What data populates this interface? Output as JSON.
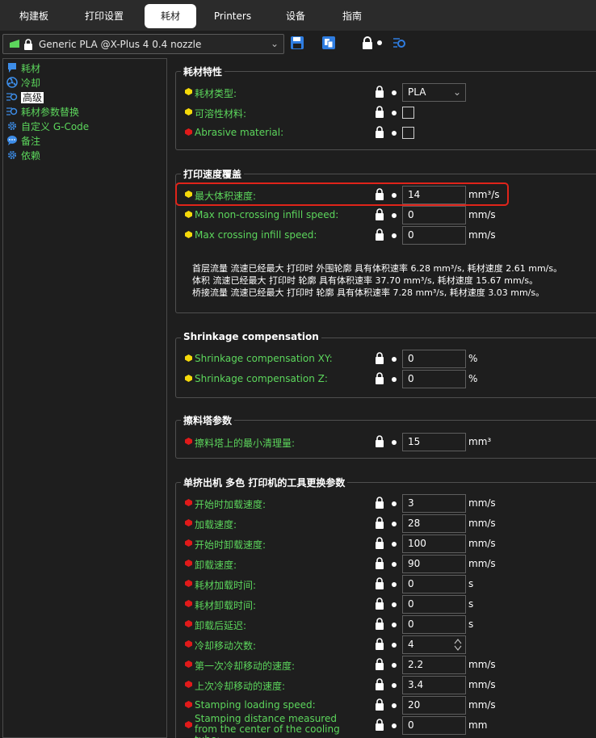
{
  "tabs": [
    {
      "label": "构建板",
      "active": false
    },
    {
      "label": "打印设置",
      "active": false
    },
    {
      "label": "耗材",
      "active": true
    },
    {
      "label": "Printers",
      "active": false
    },
    {
      "label": "设备",
      "active": false
    },
    {
      "label": "指南",
      "active": false
    }
  ],
  "preset": {
    "name": "Generic PLA @X-Plus 4 0.4 nozzle"
  },
  "sidebar": {
    "items": [
      {
        "label": "耗材",
        "icon": "filament-icon"
      },
      {
        "label": "冷却",
        "icon": "fan-icon"
      },
      {
        "label": "高级",
        "icon": "advanced-icon",
        "selected": true
      },
      {
        "label": "耗材参数替换",
        "icon": "override-icon"
      },
      {
        "label": "自定义 G-Code",
        "icon": "gear-icon"
      },
      {
        "label": "备注",
        "icon": "note-icon"
      },
      {
        "label": "依赖",
        "icon": "dependency-icon"
      }
    ]
  },
  "colors": {
    "green_label": "#5cd65c",
    "yellow_dot": "#f5d90a",
    "red_dot": "#e01a1a",
    "highlight": "#e0241a"
  },
  "sections": {
    "filament_props": {
      "title": "耗材特性",
      "rows": [
        {
          "label": "耗材类型:",
          "dot": "yellow",
          "value": "PLA",
          "kind": "select"
        },
        {
          "label": "可溶性材料:",
          "dot": "yellow",
          "kind": "checkbox"
        },
        {
          "label": "Abrasive material:",
          "dot": "red",
          "kind": "checkbox"
        }
      ]
    },
    "speed_override": {
      "title": "打印速度覆盖",
      "rows": [
        {
          "label": "最大体积速度:",
          "dot": "yellow",
          "value": "14",
          "unit": "mm³/s"
        },
        {
          "label": "Max non-crossing infill speed:",
          "dot": "yellow",
          "value": "0",
          "unit": "mm/s"
        },
        {
          "label": "Max crossing infill speed:",
          "dot": "yellow",
          "value": "0",
          "unit": "mm/s"
        }
      ],
      "notes": [
        "首层流量 流速已经最大 打印时 外围轮廓 具有体积速率 6.28 mm³/s, 耗材速度 2.61 mm/s。",
        "体积 流速已经最大 打印时 轮廓 具有体积速率 37.70 mm³/s, 耗材速度 15.67 mm/s。",
        "桥接流量 流速已经最大 打印时 轮廓 具有体积速率 7.28 mm³/s, 耗材速度 3.03 mm/s。"
      ]
    },
    "shrinkage": {
      "title": "Shrinkage compensation",
      "rows": [
        {
          "label": "Shrinkage compensation XY:",
          "dot": "yellow",
          "value": "0",
          "unit": "%"
        },
        {
          "label": "Shrinkage compensation Z:",
          "dot": "yellow",
          "value": "0",
          "unit": "%"
        }
      ]
    },
    "wipe_tower": {
      "title": "擦料塔参数",
      "rows": [
        {
          "label": "擦料塔上的最小清理量:",
          "dot": "red",
          "value": "15",
          "unit": "mm³"
        }
      ]
    },
    "toolchange": {
      "title": "单挤出机 多色 打印机的工具更换参数",
      "rows": [
        {
          "label": "开始时加载速度:",
          "dot": "red",
          "value": "3",
          "unit": "mm/s"
        },
        {
          "label": "加载速度:",
          "dot": "red",
          "value": "28",
          "unit": "mm/s"
        },
        {
          "label": "开始时卸载速度:",
          "dot": "red",
          "value": "100",
          "unit": "mm/s"
        },
        {
          "label": "卸载速度:",
          "dot": "red",
          "value": "90",
          "unit": "mm/s"
        },
        {
          "label": "耗材加载时间:",
          "dot": "red",
          "value": "0",
          "unit": "s"
        },
        {
          "label": "耗材卸载时间:",
          "dot": "red",
          "value": "0",
          "unit": "s"
        },
        {
          "label": "卸载后延迟:",
          "dot": "red",
          "value": "0",
          "unit": "s"
        },
        {
          "label": "冷却移动次数:",
          "dot": "red",
          "value": "4",
          "unit": "",
          "spinner": true
        },
        {
          "label": "第一次冷却移动的速度:",
          "dot": "red",
          "value": "2.2",
          "unit": "mm/s"
        },
        {
          "label": "上次冷却移动的速度:",
          "dot": "red",
          "value": "3.4",
          "unit": "mm/s"
        },
        {
          "label": "Stamping loading speed:",
          "dot": "red",
          "value": "20",
          "unit": "mm/s"
        },
        {
          "label": "Stamping distance measured from the center of the cooling tube:",
          "dot": "red",
          "value": "0",
          "unit": "mm"
        }
      ]
    }
  }
}
